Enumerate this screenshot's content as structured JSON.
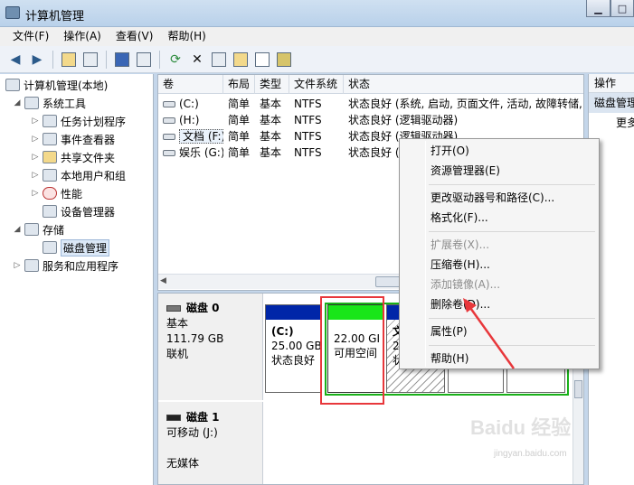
{
  "window": {
    "title": "计算机管理",
    "minimize": "▁",
    "maximize": "□"
  },
  "menu": [
    "文件(F)",
    "操作(A)",
    "查看(V)",
    "帮助(H)"
  ],
  "tree": {
    "root": "计算机管理(本地)",
    "system_tools": "系统工具",
    "task_scheduler": "任务计划程序",
    "event_viewer": "事件查看器",
    "shared_folders": "共享文件夹",
    "local_users": "本地用户和组",
    "performance": "性能",
    "device_manager": "设备管理器",
    "storage": "存储",
    "disk_management": "磁盘管理",
    "services": "服务和应用程序"
  },
  "volume_list": {
    "headers": [
      "卷",
      "布局",
      "类型",
      "文件系统",
      "状态"
    ],
    "rows": [
      {
        "name": "(C:)",
        "layout": "简单",
        "type": "基本",
        "fs": "NTFS",
        "status": "状态良好 (系统, 启动, 页面文件, 活动, 故障转储, 主"
      },
      {
        "name": "(H:)",
        "layout": "简单",
        "type": "基本",
        "fs": "NTFS",
        "status": "状态良好 (逻辑驱动器)"
      },
      {
        "name": "文档 (F:)",
        "layout": "简单",
        "type": "基本",
        "fs": "NTFS",
        "status": "状态良好 (逻辑驱动器)"
      },
      {
        "name": "娱乐 (G:)",
        "layout": "简单",
        "type": "基本",
        "fs": "NTFS",
        "status": "状态良好 (逻辑驱动器)"
      }
    ],
    "scroll_thumb": "Ⅲ"
  },
  "disks": [
    {
      "name": "磁盘 0",
      "kind": "基本",
      "size": "111.79 GB",
      "state": "联机"
    },
    {
      "name": "磁盘 1",
      "kind": "可移动 (J:)",
      "size": "",
      "state": "无媒体"
    }
  ],
  "partitions": {
    "c": {
      "label": "(C:)",
      "size": "25.00 GB",
      "status": "状态良好"
    },
    "free": {
      "size": "22.00 GI",
      "status": "可用空间"
    },
    "partial": {
      "label": "文",
      "size": "2",
      "status": "状"
    }
  },
  "actions": {
    "header": "操作",
    "sub": "磁盘管理",
    "more": "更多"
  },
  "context_menu": {
    "open": "打开(O)",
    "explorer": "资源管理器(E)",
    "change_letter": "更改驱动器号和路径(C)...",
    "format": "格式化(F)...",
    "extend": "扩展卷(X)...",
    "shrink": "压缩卷(H)...",
    "mirror": "添加镜像(A)...",
    "delete": "删除卷(D)...",
    "properties": "属性(P)",
    "help": "帮助(H)"
  },
  "watermark": {
    "brand": "Baidu 经验",
    "url": "jingyan.baidu.com"
  },
  "colors": {
    "primary_blue": "#0026a8",
    "free_green": "#19e619",
    "annotation_red": "#e8373b"
  }
}
